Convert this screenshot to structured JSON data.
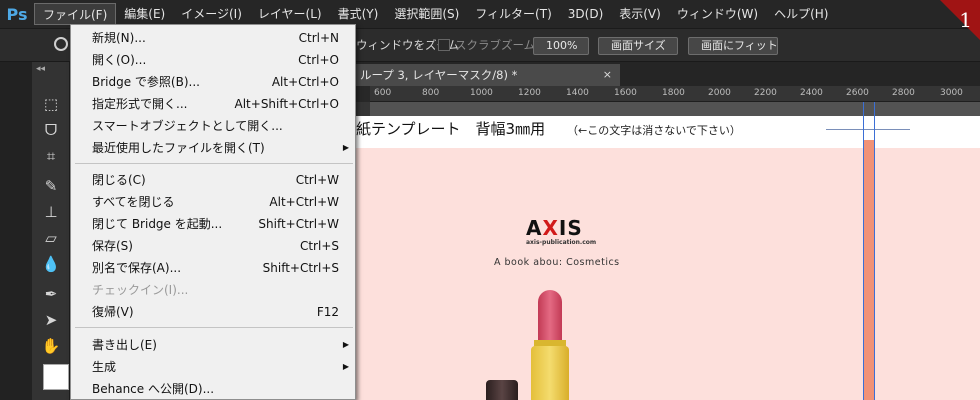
{
  "app": {
    "logo": "Ps",
    "accent": "#4ea9e6"
  },
  "menubar": {
    "items": [
      "ファイル(F)",
      "編集(E)",
      "イメージ(I)",
      "レイヤー(L)",
      "書式(Y)",
      "選択範囲(S)",
      "フィルター(T)",
      "3D(D)",
      "表示(V)",
      "ウィンドウ(W)",
      "ヘルプ(H)"
    ]
  },
  "options": {
    "zoom_windows": "ウィンドウをズーム",
    "scrubby_zoom": "スクラブズーム",
    "zoom_100": "100%",
    "fit_screen_size": "画面サイズ",
    "fit_screen": "画面にフィット"
  },
  "tab": {
    "title": "ループ 3, レイヤーマスク/8) *",
    "close": "×"
  },
  "ruler": {
    "labels": [
      "600",
      "800",
      "1000",
      "1200",
      "1400",
      "1600",
      "1800",
      "2000",
      "2200",
      "2400",
      "2600",
      "2800",
      "3000"
    ]
  },
  "document": {
    "title": "紙テンプレート　背幅3㎜用",
    "note": "（←この文字は消さないで下さい）",
    "logo_text": "AXIS",
    "logo_url": "axis-publication.com",
    "tagline": "A  book abou: Cosmetics",
    "bg_color": "#fde0dc",
    "spine_color": "#f19277"
  },
  "file_menu": {
    "items": [
      {
        "label": "新規(N)...",
        "shortcut": "Ctrl+N"
      },
      {
        "label": "開く(O)...",
        "shortcut": "Ctrl+O"
      },
      {
        "label": "Bridge で参照(B)...",
        "shortcut": "Alt+Ctrl+O"
      },
      {
        "label": "指定形式で開く...",
        "shortcut": "Alt+Shift+Ctrl+O"
      },
      {
        "label": "スマートオブジェクトとして開く...",
        "shortcut": ""
      },
      {
        "label": "最近使用したファイルを開く(T)",
        "shortcut": ""
      },
      {
        "label": "閉じる(C)",
        "shortcut": "Ctrl+W"
      },
      {
        "label": "すべてを閉じる",
        "shortcut": "Alt+Ctrl+W"
      },
      {
        "label": "閉じて Bridge を起動...",
        "shortcut": "Shift+Ctrl+W"
      },
      {
        "label": "保存(S)",
        "shortcut": "Ctrl+S"
      },
      {
        "label": "別名で保存(A)...",
        "shortcut": "Shift+Ctrl+S"
      },
      {
        "label": "チェックイン(I)...",
        "shortcut": ""
      },
      {
        "label": "復帰(V)",
        "shortcut": "F12"
      },
      {
        "label": "書き出し(E)",
        "shortcut": ""
      },
      {
        "label": "生成",
        "shortcut": ""
      },
      {
        "label": "Behance へ公開(D)...",
        "shortcut": ""
      }
    ]
  },
  "badge": {
    "number": "1",
    "color": "#a01414"
  }
}
